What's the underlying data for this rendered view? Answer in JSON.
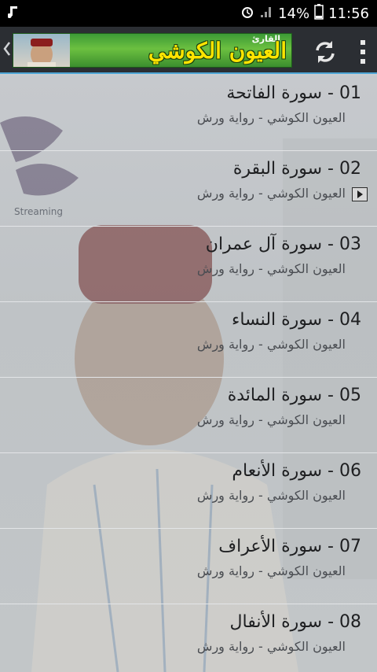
{
  "status_bar": {
    "battery_percent": "14%",
    "time": "11:56",
    "icons": [
      "music-note-icon",
      "alarm-icon",
      "signal-icon",
      "battery-icon"
    ]
  },
  "action_bar": {
    "banner_title": "العيون الكوشي",
    "banner_subtitle": "القارئ",
    "icons": [
      "back-arrow-icon",
      "refresh-icon",
      "overflow-menu-icon"
    ],
    "accent_color": "#4fa6d6"
  },
  "streaming_label": "Streaming",
  "tracks": [
    {
      "title": "01 - سورة الفاتحة",
      "subtitle": "العيون الكوشي - رواية ورش",
      "playing": false
    },
    {
      "title": "02 - سورة البقرة",
      "subtitle": "العيون الكوشي - رواية ورش",
      "playing": true
    },
    {
      "title": "03 - سورة آل عمران",
      "subtitle": "العيون الكوشي - رواية ورش",
      "playing": false
    },
    {
      "title": "04 - سورة النساء",
      "subtitle": "العيون الكوشي - رواية ورش",
      "playing": false
    },
    {
      "title": "05 - سورة المائدة",
      "subtitle": "العيون الكوشي - رواية ورش",
      "playing": false
    },
    {
      "title": "06 - سورة الأنعام",
      "subtitle": "العيون الكوشي - رواية ورش",
      "playing": false
    },
    {
      "title": "07 - سورة الأعراف",
      "subtitle": "العيون الكوشي - رواية ورش",
      "playing": false
    },
    {
      "title": "08 - سورة الأنفال",
      "subtitle": "العيون الكوشي - رواية ورش",
      "playing": false
    }
  ]
}
